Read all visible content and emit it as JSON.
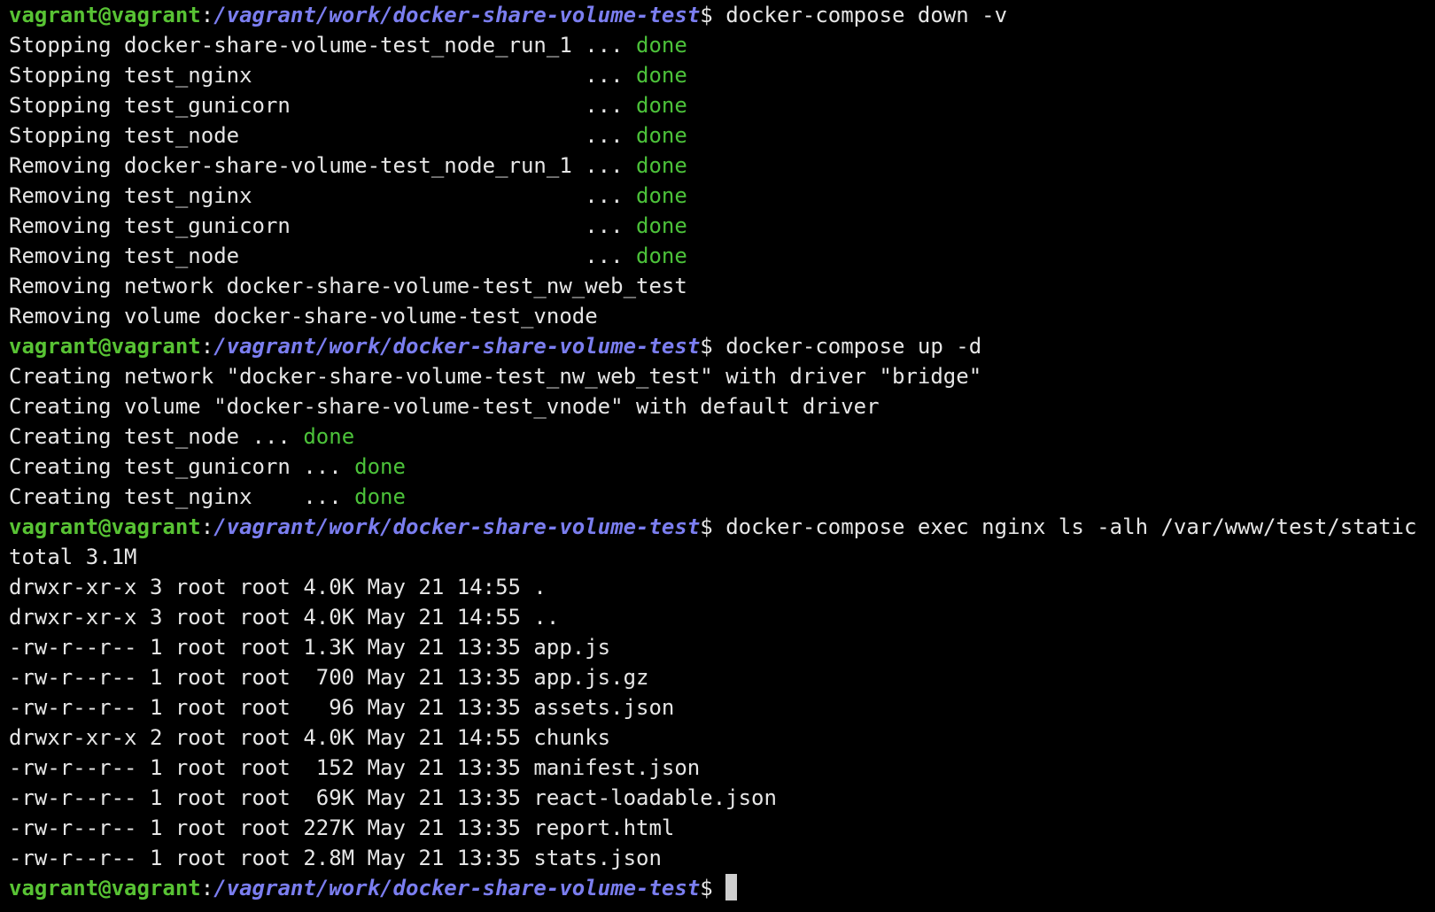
{
  "colors": {
    "background": "#000000",
    "foreground": "#e6e6e6",
    "prompt_user": "#58c334",
    "prompt_path": "#7b7ef0",
    "status_done": "#4cc23a",
    "cursor": "#cfcfcf"
  },
  "lines": [
    {
      "kind": "prompt",
      "user": "vagrant@vagrant",
      "colon": ":",
      "path": "/vagrant/work/docker-share-volume-test",
      "symbol": "$ ",
      "command": "docker-compose down -v"
    },
    {
      "kind": "status",
      "text": "Stopping docker-share-volume-test_node_run_1 ... ",
      "status": "done"
    },
    {
      "kind": "status",
      "text": "Stopping test_nginx                          ... ",
      "status": "done"
    },
    {
      "kind": "status",
      "text": "Stopping test_gunicorn                       ... ",
      "status": "done"
    },
    {
      "kind": "status",
      "text": "Stopping test_node                           ... ",
      "status": "done"
    },
    {
      "kind": "status",
      "text": "Removing docker-share-volume-test_node_run_1 ... ",
      "status": "done"
    },
    {
      "kind": "status",
      "text": "Removing test_nginx                          ... ",
      "status": "done"
    },
    {
      "kind": "status",
      "text": "Removing test_gunicorn                       ... ",
      "status": "done"
    },
    {
      "kind": "status",
      "text": "Removing test_node                           ... ",
      "status": "done"
    },
    {
      "kind": "plain",
      "text": "Removing network docker-share-volume-test_nw_web_test"
    },
    {
      "kind": "plain",
      "text": "Removing volume docker-share-volume-test_vnode"
    },
    {
      "kind": "prompt",
      "user": "vagrant@vagrant",
      "colon": ":",
      "path": "/vagrant/work/docker-share-volume-test",
      "symbol": "$ ",
      "command": "docker-compose up -d"
    },
    {
      "kind": "plain",
      "text": "Creating network \"docker-share-volume-test_nw_web_test\" with driver \"bridge\""
    },
    {
      "kind": "plain",
      "text": "Creating volume \"docker-share-volume-test_vnode\" with default driver"
    },
    {
      "kind": "status",
      "text": "Creating test_node ... ",
      "status": "done"
    },
    {
      "kind": "status",
      "text": "Creating test_gunicorn ... ",
      "status": "done"
    },
    {
      "kind": "status",
      "text": "Creating test_nginx    ... ",
      "status": "done"
    },
    {
      "kind": "prompt",
      "user": "vagrant@vagrant",
      "colon": ":",
      "path": "/vagrant/work/docker-share-volume-test",
      "symbol": "$ ",
      "command": "docker-compose exec nginx ls -alh /var/www/test/static"
    },
    {
      "kind": "plain",
      "text": "total 3.1M"
    },
    {
      "kind": "plain",
      "text": "drwxr-xr-x 3 root root 4.0K May 21 14:55 ."
    },
    {
      "kind": "plain",
      "text": "drwxr-xr-x 3 root root 4.0K May 21 14:55 .."
    },
    {
      "kind": "plain",
      "text": "-rw-r--r-- 1 root root 1.3K May 21 13:35 app.js"
    },
    {
      "kind": "plain",
      "text": "-rw-r--r-- 1 root root  700 May 21 13:35 app.js.gz"
    },
    {
      "kind": "plain",
      "text": "-rw-r--r-- 1 root root   96 May 21 13:35 assets.json"
    },
    {
      "kind": "plain",
      "text": "drwxr-xr-x 2 root root 4.0K May 21 14:55 chunks"
    },
    {
      "kind": "plain",
      "text": "-rw-r--r-- 1 root root  152 May 21 13:35 manifest.json"
    },
    {
      "kind": "plain",
      "text": "-rw-r--r-- 1 root root  69K May 21 13:35 react-loadable.json"
    },
    {
      "kind": "plain",
      "text": "-rw-r--r-- 1 root root 227K May 21 13:35 report.html"
    },
    {
      "kind": "plain",
      "text": "-rw-r--r-- 1 root root 2.8M May 21 13:35 stats.json"
    },
    {
      "kind": "prompt",
      "user": "vagrant@vagrant",
      "colon": ":",
      "path": "/vagrant/work/docker-share-volume-test",
      "symbol": "$ ",
      "command": "",
      "cursor": true
    }
  ]
}
